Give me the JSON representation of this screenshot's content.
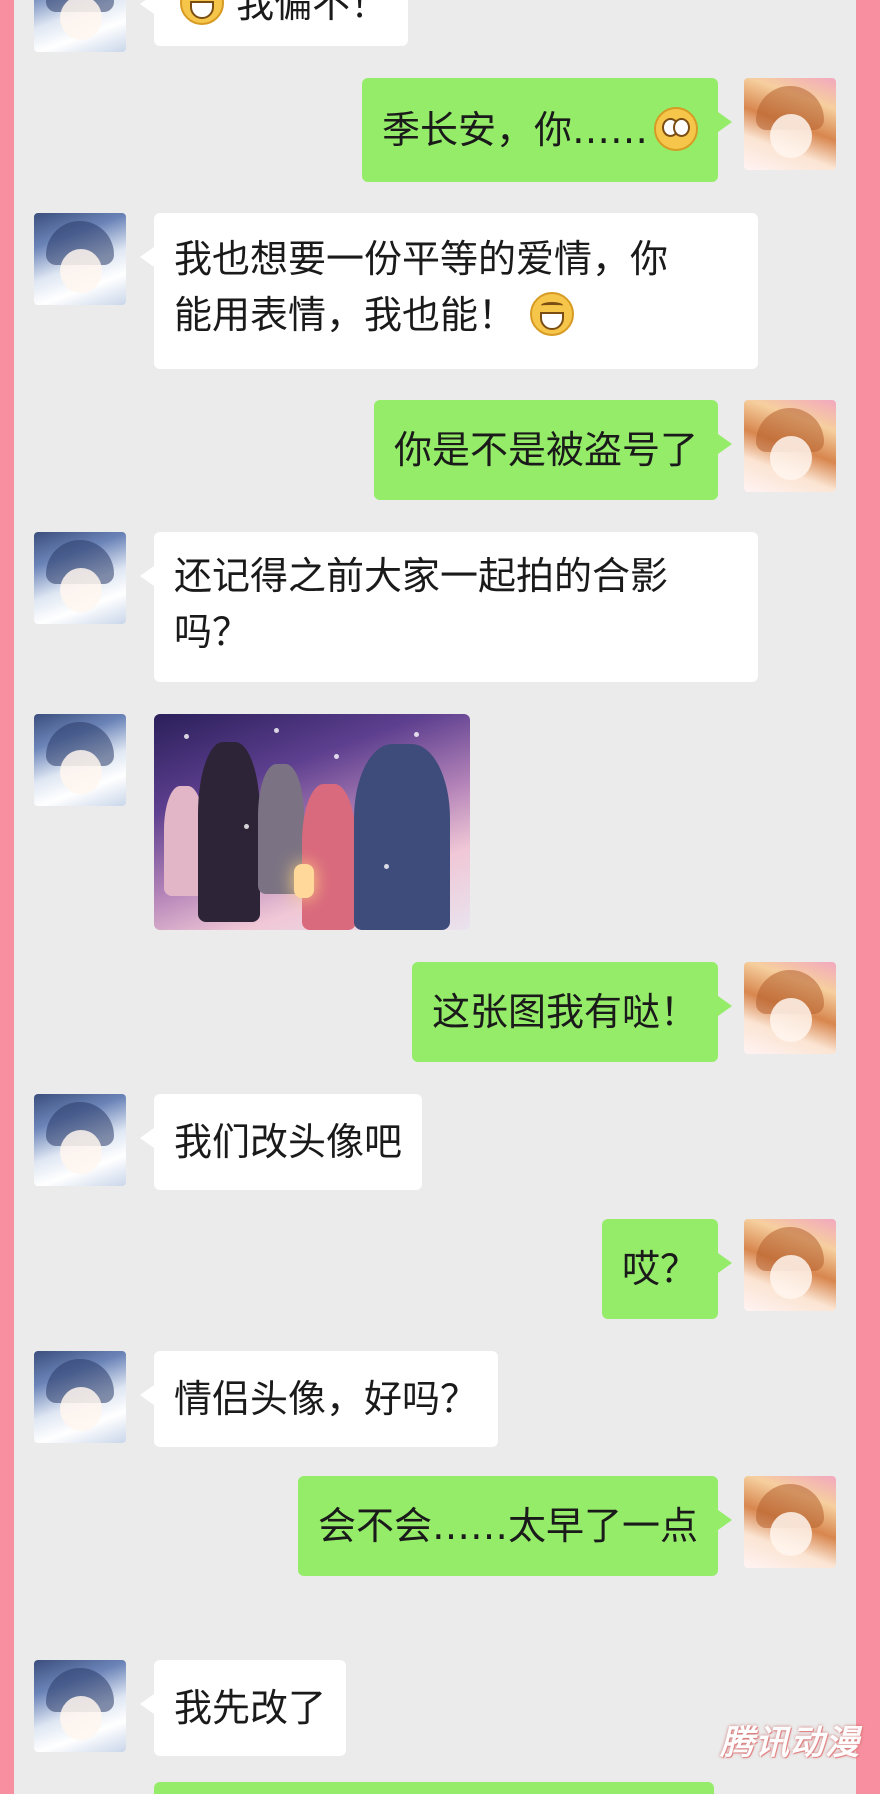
{
  "messages": [
    {
      "side": "in",
      "text": "我偏不！",
      "emoji_before": "sly-face"
    },
    {
      "side": "out",
      "text": "季长安，你……",
      "emoji_after": "rolling-eyes"
    },
    {
      "side": "in",
      "line1": "我也想要一份平等的爱情，你",
      "line2": "能用表情，我也能！",
      "emoji_after": "grinning"
    },
    {
      "side": "out",
      "text": "你是不是被盗号了"
    },
    {
      "side": "in",
      "line1": "还记得之前大家一起拍的合影",
      "line2": "吗？"
    },
    {
      "side": "in",
      "type": "image",
      "image": "group-photo"
    },
    {
      "side": "out",
      "text": "这张图我有哒！"
    },
    {
      "side": "in",
      "text": "我们改头像吧"
    },
    {
      "side": "out",
      "text": "哎？"
    },
    {
      "side": "in",
      "text": "情侣头像，好吗？"
    },
    {
      "side": "out",
      "text": "会不会……太早了一点"
    },
    {
      "side": "in",
      "text": "我先改了"
    }
  ],
  "colors": {
    "frame": "#f78fa1",
    "chat_bg": "#ebebeb",
    "incoming_bubble": "#ffffff",
    "outgoing_bubble": "#95ec69"
  },
  "watermark": "腾讯动漫"
}
